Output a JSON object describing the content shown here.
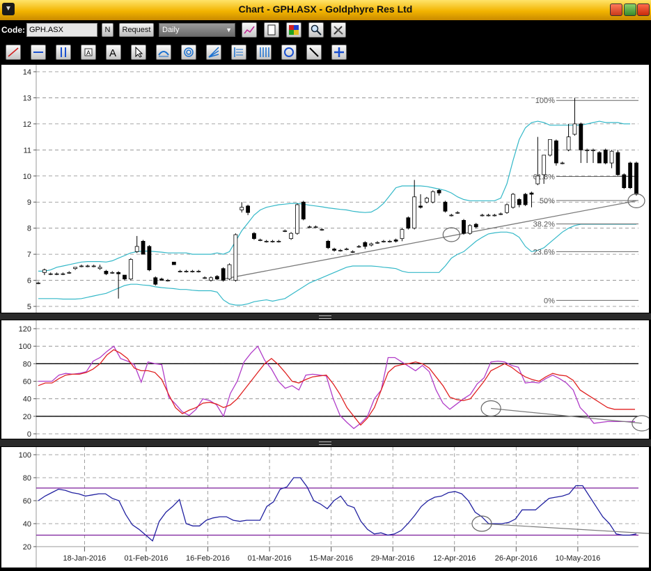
{
  "window": {
    "title": "Chart - GPH.ASX - Goldphyre Res Ltd"
  },
  "toolbar": {
    "code_label": "Code:",
    "code_value": "GPH.ASX",
    "n_label": "N",
    "request_label": "Request",
    "interval": "Daily"
  },
  "colors": {
    "bollinger": "#33b8c8",
    "stoch_k": "#b03cc8",
    "stoch_d": "#e02020",
    "rsi": "#2020a0",
    "rsi_band": "#7a1a9a",
    "trend": "#7a7a7a"
  },
  "icons": [
    "line-tool-icon",
    "horizontal-line-icon",
    "vertical-line-icon",
    "text-note-icon",
    "text-icon",
    "pointer-icon",
    "fibonacci-retracement-icon",
    "fibonacci-circle-icon",
    "fan-icon",
    "fibonacci-time-icon",
    "gann-icon",
    "circle-icon",
    "arrow-line-icon",
    "crosshair-icon"
  ],
  "chart_data": [
    {
      "type": "candlestick",
      "yticks": [
        5,
        6,
        7,
        8,
        9,
        10,
        11,
        12,
        13,
        14
      ],
      "ylim": [
        5,
        14
      ],
      "candles": [
        [
          5.9,
          5.95,
          5.85,
          5.9
        ],
        [
          6.3,
          6.45,
          6.2,
          6.4
        ],
        [
          6.25,
          6.3,
          6.2,
          6.25
        ],
        [
          6.25,
          6.3,
          6.2,
          6.25
        ],
        [
          6.25,
          6.3,
          6.2,
          6.25
        ],
        [
          6.3,
          6.35,
          6.25,
          6.3
        ],
        [
          6.45,
          6.5,
          6.4,
          6.5
        ],
        [
          6.55,
          6.6,
          6.5,
          6.55
        ],
        [
          6.55,
          6.6,
          6.5,
          6.55
        ],
        [
          6.55,
          6.6,
          6.5,
          6.55
        ],
        [
          6.45,
          6.6,
          6.4,
          6.5
        ],
        [
          6.35,
          6.4,
          6.2,
          6.25
        ],
        [
          6.3,
          6.35,
          6.25,
          6.3
        ],
        [
          6.3,
          6.35,
          5.3,
          6.25
        ],
        [
          6.2,
          6.2,
          6.0,
          6.05
        ],
        [
          6.05,
          6.85,
          6.0,
          6.8
        ],
        [
          7.1,
          7.7,
          7.05,
          7.3
        ],
        [
          7.5,
          7.55,
          7.0,
          7.0
        ],
        [
          7.3,
          7.35,
          6.35,
          6.4
        ],
        [
          6.1,
          6.15,
          5.8,
          5.85
        ],
        [
          6.05,
          6.1,
          6.0,
          6.0
        ],
        [
          6.0,
          6.05,
          5.95,
          6.0
        ],
        [
          6.7,
          6.7,
          6.6,
          6.6
        ],
        [
          6.35,
          6.4,
          6.3,
          6.35
        ],
        [
          6.35,
          6.4,
          6.3,
          6.35
        ],
        [
          6.35,
          6.4,
          6.3,
          6.35
        ],
        [
          6.35,
          6.4,
          6.3,
          6.35
        ],
        [
          6.1,
          6.15,
          6.05,
          6.1
        ],
        [
          6.0,
          6.15,
          5.95,
          6.1
        ],
        [
          6.15,
          6.2,
          6.0,
          6.05
        ],
        [
          6.45,
          6.5,
          5.95,
          6.0
        ],
        [
          6.05,
          6.65,
          6.0,
          6.6
        ],
        [
          6.0,
          7.8,
          5.95,
          7.75
        ],
        [
          8.7,
          9.0,
          8.6,
          8.8
        ],
        [
          8.85,
          8.9,
          8.5,
          8.6
        ],
        [
          7.8,
          7.85,
          7.55,
          7.6
        ],
        [
          7.55,
          7.6,
          7.5,
          7.55
        ],
        [
          7.5,
          7.55,
          7.45,
          7.5
        ],
        [
          7.5,
          7.55,
          7.45,
          7.5
        ],
        [
          7.5,
          7.55,
          7.45,
          7.5
        ],
        [
          7.9,
          7.95,
          7.85,
          7.9
        ],
        [
          7.6,
          7.85,
          7.55,
          7.8
        ],
        [
          7.8,
          8.95,
          7.75,
          8.9
        ],
        [
          9.0,
          9.05,
          8.3,
          8.35
        ],
        [
          8.05,
          8.1,
          8.0,
          8.05
        ],
        [
          8.05,
          8.1,
          8.0,
          8.05
        ],
        [
          7.95,
          8.0,
          7.9,
          7.95
        ],
        [
          7.5,
          7.55,
          7.2,
          7.25
        ],
        [
          7.2,
          7.25,
          7.1,
          7.15
        ],
        [
          7.15,
          7.2,
          7.1,
          7.15
        ],
        [
          7.2,
          7.25,
          7.15,
          7.2
        ],
        [
          7.1,
          7.15,
          7.05,
          7.1
        ],
        [
          7.3,
          7.35,
          7.25,
          7.3
        ],
        [
          7.45,
          7.5,
          7.2,
          7.3
        ],
        [
          7.35,
          7.45,
          7.3,
          7.4
        ],
        [
          7.45,
          7.5,
          7.4,
          7.45
        ],
        [
          7.5,
          7.55,
          7.45,
          7.5
        ],
        [
          7.5,
          7.55,
          7.45,
          7.5
        ],
        [
          7.55,
          7.6,
          7.45,
          7.5
        ],
        [
          7.6,
          8.0,
          7.5,
          7.95
        ],
        [
          8.4,
          8.45,
          7.95,
          8.0
        ],
        [
          8.0,
          9.85,
          7.95,
          9.2
        ],
        [
          8.85,
          9.3,
          8.75,
          8.8
        ],
        [
          9.0,
          9.2,
          8.95,
          9.15
        ],
        [
          9.0,
          9.45,
          8.95,
          9.4
        ],
        [
          9.45,
          9.5,
          9.25,
          9.35
        ],
        [
          9.0,
          9.05,
          8.6,
          8.65
        ],
        [
          8.5,
          8.55,
          8.45,
          8.5
        ],
        [
          8.6,
          8.65,
          8.55,
          8.6
        ],
        [
          8.3,
          8.35,
          7.75,
          7.8
        ],
        [
          7.8,
          8.15,
          7.75,
          8.1
        ],
        [
          8.15,
          8.2,
          8.0,
          8.05
        ],
        [
          8.5,
          8.55,
          8.45,
          8.5
        ],
        [
          8.5,
          8.55,
          8.45,
          8.5
        ],
        [
          8.5,
          8.55,
          8.45,
          8.5
        ],
        [
          8.55,
          8.6,
          8.5,
          8.55
        ],
        [
          8.6,
          8.95,
          8.55,
          8.9
        ],
        [
          8.8,
          9.35,
          8.75,
          9.3
        ],
        [
          9.1,
          9.15,
          8.8,
          8.9
        ],
        [
          9.3,
          9.35,
          8.85,
          8.9
        ],
        [
          9.35,
          9.4,
          8.8,
          9.3
        ],
        [
          9.7,
          11.5,
          9.65,
          10.0
        ],
        [
          10.05,
          10.8,
          9.7,
          10.8
        ],
        [
          10.8,
          11.4,
          10.75,
          11.4
        ],
        [
          11.35,
          11.4,
          10.4,
          10.5
        ],
        [
          10.5,
          10.55,
          10.45,
          10.5
        ],
        [
          11.0,
          12.0,
          10.95,
          11.5
        ],
        [
          11.6,
          13.0,
          11.55,
          12.0
        ],
        [
          12.0,
          12.05,
          10.5,
          11.0
        ],
        [
          11.0,
          11.05,
          10.5,
          11.0
        ],
        [
          11.0,
          11.05,
          10.5,
          11.0
        ],
        [
          10.9,
          10.95,
          10.5,
          10.5
        ],
        [
          11.0,
          11.05,
          10.45,
          10.5
        ],
        [
          10.5,
          11.0,
          10.3,
          10.95
        ],
        [
          10.9,
          11.0,
          10.0,
          10.05
        ],
        [
          10.05,
          10.1,
          9.5,
          9.55
        ],
        [
          10.5,
          10.55,
          9.5,
          9.55
        ],
        [
          10.5,
          10.55,
          9.25,
          9.3
        ]
      ],
      "bollinger_upper": [
        6.35,
        6.35,
        6.4,
        6.5,
        6.55,
        6.6,
        6.65,
        6.7,
        6.72,
        6.72,
        6.72,
        6.7,
        6.75,
        6.85,
        6.95,
        7.05,
        7.1,
        7.12,
        7.12,
        7.1,
        7.08,
        7.05,
        7.05,
        7.05,
        7.05,
        7.0,
        7.0,
        7.0,
        7.0,
        7.05,
        7.0,
        7.1,
        7.5,
        7.9,
        8.2,
        8.5,
        8.7,
        8.8,
        8.85,
        8.9,
        8.92,
        8.95,
        8.95,
        8.92,
        8.88,
        8.85,
        8.82,
        8.78,
        8.75,
        8.72,
        8.7,
        8.65,
        8.62,
        8.6,
        8.62,
        8.75,
        8.95,
        9.25,
        9.55,
        9.62,
        9.62,
        9.62,
        9.62,
        9.6,
        9.55,
        9.5,
        9.45,
        9.35,
        9.2,
        9.1,
        9.05,
        9.05,
        9.05,
        9.05,
        9.05,
        9.15,
        9.7,
        10.6,
        11.4,
        11.85,
        12.05,
        12.1,
        12.05,
        11.95,
        11.95,
        11.95,
        11.95,
        11.95,
        11.95,
        12.0,
        12.05,
        12.1,
        12.05,
        12.05,
        12.05,
        12.0,
        12.0
      ],
      "bollinger_lower": [
        5.3,
        5.3,
        5.3,
        5.3,
        5.28,
        5.28,
        5.28,
        5.3,
        5.35,
        5.4,
        5.45,
        5.5,
        5.6,
        5.7,
        5.8,
        5.85,
        5.85,
        5.82,
        5.8,
        5.75,
        5.72,
        5.7,
        5.68,
        5.65,
        5.65,
        5.62,
        5.6,
        5.6,
        5.6,
        5.55,
        5.25,
        5.1,
        5.05,
        5.05,
        5.1,
        5.18,
        5.22,
        5.25,
        5.2,
        5.25,
        5.3,
        5.45,
        5.6,
        5.75,
        5.9,
        6.0,
        6.1,
        6.2,
        6.3,
        6.4,
        6.5,
        6.55,
        6.55,
        6.55,
        6.55,
        6.53,
        6.5,
        6.48,
        6.45,
        6.35,
        6.3,
        6.3,
        6.3,
        6.3,
        6.3,
        6.3,
        6.55,
        6.85,
        7.0,
        7.1,
        7.3,
        7.5,
        7.65,
        7.78,
        7.82,
        7.85,
        7.85,
        7.8,
        7.65,
        7.3,
        7.1,
        7.15,
        7.25,
        7.45,
        7.65,
        7.85,
        8.0,
        8.1,
        8.15,
        8.15,
        8.15,
        8.15,
        8.15,
        8.15,
        8.15,
        8.15,
        8.15,
        8.15
      ],
      "trendline": [
        [
          30,
          6.05
        ],
        [
          97,
          9.05
        ]
      ],
      "fibonacci": [
        {
          "label": "100%",
          "value": 12.9
        },
        {
          "label": "61.8%",
          "value": 9.98
        },
        {
          "label": "50%",
          "value": 9.06
        },
        {
          "label": "38.2%",
          "value": 8.16
        },
        {
          "label": "23.6%",
          "value": 7.1
        },
        {
          "label": "0%",
          "value": 5.23
        }
      ],
      "circles": [
        [
          67,
          7.75
        ],
        [
          97,
          9.05
        ]
      ]
    },
    {
      "type": "line",
      "title": "",
      "yticks": [
        0,
        20,
        40,
        60,
        80,
        100,
        120
      ],
      "ylim": [
        0,
        120
      ],
      "levels": [
        20,
        80
      ],
      "series": [
        {
          "values": [
            60,
            60,
            60,
            67,
            69,
            68,
            69,
            71,
            83,
            87,
            94,
            100,
            86,
            83,
            79,
            59,
            82,
            80,
            79,
            42,
            34,
            25,
            21,
            28,
            40,
            38,
            33,
            20,
            46,
            60,
            82,
            92,
            100,
            84,
            74,
            60,
            52,
            55,
            50,
            67,
            68,
            67,
            66,
            40,
            21,
            13,
            6,
            12,
            20,
            40,
            50,
            87,
            87,
            82,
            77,
            72,
            78,
            71,
            50,
            35,
            28,
            34,
            40,
            45,
            57,
            64,
            82,
            83,
            82,
            78,
            76,
            58,
            59,
            58,
            63,
            67,
            63,
            58,
            50,
            30,
            22,
            12,
            13,
            14,
            14,
            14,
            14,
            14
          ]
        },
        {
          "values": [
            55,
            58,
            58,
            63,
            67,
            68,
            68,
            70,
            74,
            80,
            90,
            96,
            92,
            86,
            75,
            72,
            72,
            70,
            62,
            45,
            30,
            23,
            27,
            30,
            35,
            36,
            34,
            30,
            33,
            40,
            50,
            60,
            70,
            80,
            86,
            79,
            70,
            60,
            58,
            62,
            65,
            66,
            67,
            57,
            45,
            30,
            20,
            10,
            18,
            30,
            50,
            70,
            77,
            79,
            80,
            82,
            80,
            75,
            65,
            55,
            42,
            39,
            38,
            40,
            50,
            60,
            72,
            76,
            80,
            76,
            70,
            65,
            62,
            60,
            65,
            69,
            67,
            66,
            61,
            50,
            45,
            40,
            35,
            30,
            28,
            28,
            28,
            28
          ]
        }
      ],
      "trendline": [
        [
          66,
          29
        ],
        [
          88,
          12
        ]
      ],
      "circles": [
        [
          66,
          29
        ],
        [
          88,
          12
        ]
      ]
    },
    {
      "type": "line",
      "title": "",
      "yticks": [
        20,
        40,
        60,
        80,
        100
      ],
      "ylim": [
        20,
        100
      ],
      "levels": [
        30,
        71
      ],
      "xticks": [
        {
          "label": "18-Jan-2016",
          "at": 7.5
        },
        {
          "label": "01-Feb-2016",
          "at": 17.5
        },
        {
          "label": "16-Feb-2016",
          "at": 27.5
        },
        {
          "label": "01-Mar-2016",
          "at": 37.5
        },
        {
          "label": "15-Mar-2016",
          "at": 47.5
        },
        {
          "label": "29-Mar-2016",
          "at": 57.5
        },
        {
          "label": "12-Apr-2016",
          "at": 67.5
        },
        {
          "label": "26-Apr-2016",
          "at": 77.5
        },
        {
          "label": "10-May-2016",
          "at": 87.5
        }
      ],
      "series": [
        {
          "values": [
            60,
            64,
            67,
            70,
            69,
            67,
            66,
            64,
            65,
            66,
            66,
            62,
            60,
            48,
            39,
            35,
            30,
            25,
            42,
            50,
            55,
            61,
            40,
            38,
            38,
            43,
            45,
            46,
            46,
            43,
            42,
            43,
            43,
            43,
            55,
            59,
            70,
            72,
            80,
            80,
            72,
            60,
            57,
            53,
            60,
            64,
            56,
            54,
            42,
            35,
            31,
            32,
            30,
            31,
            34,
            40,
            47,
            55,
            60,
            63,
            64,
            67,
            68,
            66,
            60,
            50,
            46,
            40,
            40,
            40,
            41,
            44,
            52,
            52,
            52,
            57,
            62,
            63,
            64,
            66,
            73,
            73,
            64,
            55,
            46,
            40,
            31,
            30,
            30,
            31
          ]
        }
      ],
      "trendline": [
        [
          66,
          40
        ],
        [
          95,
          30
        ]
      ],
      "circles": [
        [
          66,
          40
        ],
        [
          95,
          30
        ]
      ]
    }
  ]
}
